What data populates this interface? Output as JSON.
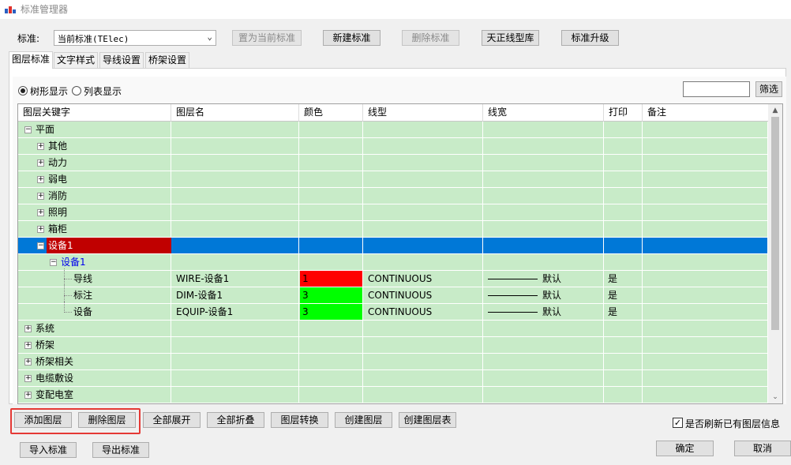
{
  "window": {
    "title": "标准管理器"
  },
  "toolbar": {
    "standard_label": "标准:",
    "standard_value": "当前标准(TElec)",
    "set_current_btn": "置为当前标准",
    "new_btn": "新建标准",
    "delete_btn": "删除标准",
    "tz_linetype_btn": "天正线型库",
    "upgrade_btn": "标准升级"
  },
  "tabs": [
    {
      "label": "图层标准",
      "active": true
    },
    {
      "label": "文字样式"
    },
    {
      "label": "导线设置"
    },
    {
      "label": "桥架设置"
    }
  ],
  "view": {
    "tree_label": "树形显示",
    "list_label": "列表显示",
    "mode": "tree",
    "filter_value": "",
    "filter_btn": "筛选"
  },
  "grid": {
    "columns": [
      "图层关键字",
      "图层名",
      "颜色",
      "线型",
      "线宽",
      "打印",
      "备注"
    ],
    "rows": [
      {
        "key": "平面",
        "level": 0,
        "expander": "−"
      },
      {
        "key": "其他",
        "level": 1,
        "expander": "+"
      },
      {
        "key": "动力",
        "level": 1,
        "expander": "+"
      },
      {
        "key": "弱电",
        "level": 1,
        "expander": "+"
      },
      {
        "key": "消防",
        "level": 1,
        "expander": "+"
      },
      {
        "key": "照明",
        "level": 1,
        "expander": "+"
      },
      {
        "key": "箱柜",
        "level": 1,
        "expander": "+"
      },
      {
        "key": "设备1",
        "level": 1,
        "expander": "−",
        "selected": true
      },
      {
        "key": "设备1",
        "level": 2,
        "expander": "−",
        "blue": true
      },
      {
        "key": "导线",
        "level": 3,
        "layer": "WIRE-设备1",
        "color": "1",
        "color_hex": "#ff0000",
        "linetype": "CONTINUOUS",
        "lineweight": "默认",
        "print": "是"
      },
      {
        "key": "标注",
        "level": 3,
        "layer": "DIM-设备1",
        "color": "3",
        "color_hex": "#00ff00",
        "linetype": "CONTINUOUS",
        "lineweight": "默认",
        "print": "是"
      },
      {
        "key": "设备",
        "level": 3,
        "layer": "EQUIP-设备1",
        "color": "3",
        "color_hex": "#00ff00",
        "linetype": "CONTINUOUS",
        "lineweight": "默认",
        "print": "是"
      },
      {
        "key": "系统",
        "level": 0,
        "expander": "+"
      },
      {
        "key": "桥架",
        "level": 0,
        "expander": "+"
      },
      {
        "key": "桥架相关",
        "level": 0,
        "expander": "+"
      },
      {
        "key": "电缆敷设",
        "level": 0,
        "expander": "+"
      },
      {
        "key": "变配电室",
        "level": 0,
        "expander": "+"
      }
    ]
  },
  "actions": {
    "add_layer": "添加图层",
    "delete_layer": "删除图层",
    "expand_all": "全部展开",
    "collapse_all": "全部折叠",
    "convert_layer": "图层转换",
    "create_layer": "创建图层",
    "create_layer_table": "创建图层表",
    "refresh_label": "是否刷新已有图层信息",
    "refresh_checked": true
  },
  "footer": {
    "import_btn": "导入标准",
    "export_btn": "导出标准",
    "ok_btn": "确定",
    "cancel_btn": "取消"
  },
  "colors": {
    "row_bg": "#c8ebc8",
    "selected_bg": "#0078d7",
    "selected_key_bg": "#c00000",
    "highlight_border": "#e53935"
  }
}
